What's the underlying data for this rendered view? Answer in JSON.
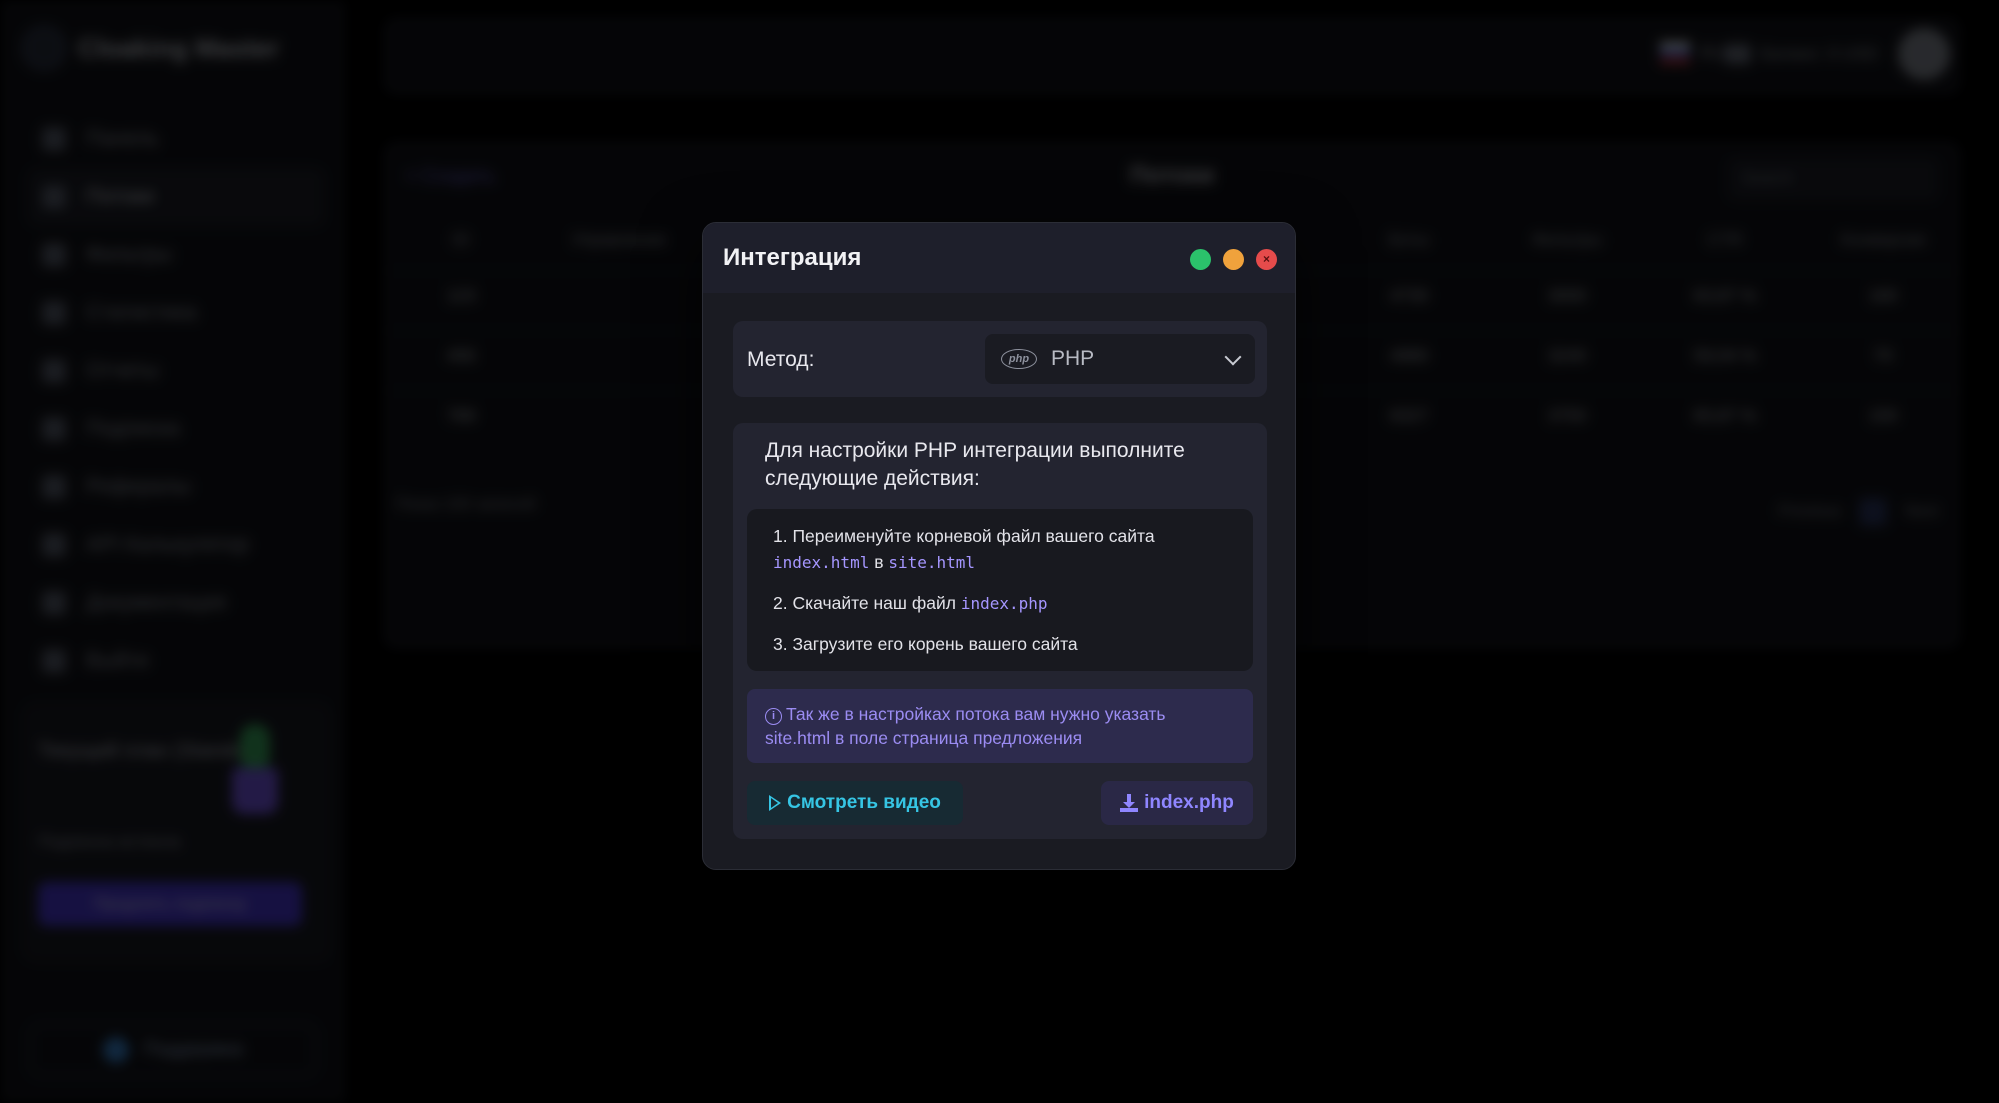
{
  "background": {
    "brand": "Cloaking Master",
    "nav": [
      "Панель",
      "Потоки",
      "Фильтры",
      "Статистика",
      "Отчеты",
      "Подписка",
      "Рефералы",
      "API Калькулятор",
      "Документация",
      "Выйти"
    ],
    "promo": {
      "title": "Текущий план (Standard)",
      "subtitle": "Подписка истекла",
      "button": "Продлить подписку"
    },
    "support": "Поддержка",
    "topbar": {
      "lang": "RU",
      "balance": "Баланс: 0 USD"
    },
    "page": {
      "back": "< Создать",
      "title": "Потоки",
      "search": "Search",
      "columns": [
        "ID",
        "Управление",
        "",
        "",
        "",
        "Визиты",
        "Боты",
        "Фильтры",
        "CTR",
        "Конверсии"
      ],
      "rows": [
        [
          "123",
          "",
          "",
          "",
          "",
          "520",
          "4730",
          "3000",
          "63,87 %",
          "160"
        ],
        [
          "456",
          "",
          "",
          "",
          "",
          "3210",
          "4980",
          "3240",
          "59,04 %",
          "70"
        ],
        [
          "789",
          "",
          "",
          "",
          "",
          "4830",
          "6327",
          "3750",
          "65,87 %",
          "150"
        ]
      ],
      "footer": "Показ 100 записей",
      "pager": {
        "prev": "Previous",
        "next": "Next"
      }
    }
  },
  "modal": {
    "title": "Интеграция",
    "close_label": "×",
    "method": {
      "label": "Метод:",
      "badge": "php",
      "value": "PHP"
    },
    "intro": "Для настройки PHP интеграции выполните следующие действия:",
    "steps": [
      {
        "text_a": "1. Переименуйте корневой файл вашего сайта ",
        "code_a": "index.html",
        "text_b": " в ",
        "code_b": "site.html"
      },
      {
        "text_a": "2. Скачайте наш файл ",
        "code_a": "index.php"
      },
      {
        "text_a": "3. Загрузите его корень вашего сайта"
      }
    ],
    "notice_icon": "i",
    "notice": "Так же в настройках потока вам нужно указать site.html в поле страница предложения",
    "video_button": "Смотреть видео",
    "download_button": "index.php"
  },
  "colors": {
    "accent": "#8f86ff",
    "video": "#36c5e4",
    "code": "#a596ff"
  }
}
